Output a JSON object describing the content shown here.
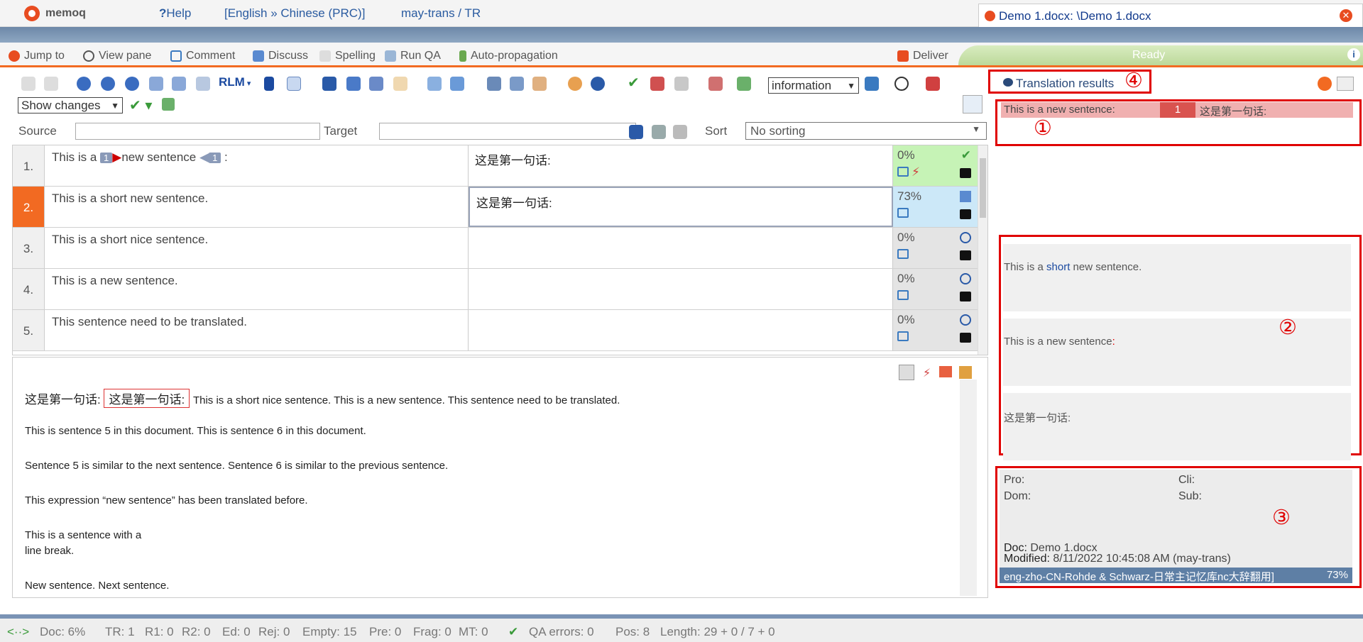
{
  "app": {
    "name": "memoq",
    "help": "Help",
    "lang": "[English » Chinese (PRC)]",
    "project": "may-trans / TR",
    "doc_tab": "Demo 1.docx: \\Demo 1.docx"
  },
  "ribbon": {
    "jump": "Jump to",
    "view": "View pane",
    "comment": "Comment",
    "discuss": "Discuss",
    "spelling": "Spelling",
    "runqa": "Run QA",
    "autoprop": "Auto-propagation",
    "deliver": "Deliver",
    "status": "Ready"
  },
  "toolbar": {
    "rlm": "RLM",
    "info_select": "information",
    "show_changes": "Show changes"
  },
  "filter": {
    "source": "Source",
    "target": "Target",
    "sort": "Sort",
    "sort_value": "No sorting"
  },
  "rows": [
    {
      "num": "1.",
      "src_a": "This is a",
      "tag_open": "1",
      "src_b": "new sentence",
      "tag_close": "1",
      "src_c": ":",
      "tgt": "这是第一句话:",
      "pct": "0%"
    },
    {
      "num": "2.",
      "src": "This is a short new sentence.",
      "tgt": "这是第一句话:",
      "pct": "73%"
    },
    {
      "num": "3.",
      "src": "This is a short nice sentence.",
      "tgt": "",
      "pct": "0%"
    },
    {
      "num": "4.",
      "src": "This is a new sentence.",
      "tgt": "",
      "pct": "0%"
    },
    {
      "num": "5.",
      "src": "This sentence need to be translated.",
      "tgt": "",
      "pct": "0%"
    }
  ],
  "preview": {
    "p1a": "这是第一句话:",
    "p1hl": "这是第一句话:",
    "p1b": "This is a short nice sentence. This is a new sentence. This sentence need to be translated.",
    "p2": "This is sentence 5 in this document. This is sentence 6 in this document.",
    "p3": "Sentence 5 is similar to the next sentence. Sentence 6 is similar to the previous sentence.",
    "p4": "This expression “new sentence” has been translated before.",
    "p5a": "This is a sentence with a",
    "p5b": "line break.",
    "p6": "New sentence. Next sentence."
  },
  "results": {
    "title": "Translation results",
    "r1_src": "This is a new sentence:",
    "r1_num": "1",
    "r1_tgt": "这是第一句话:",
    "r2a_pre": "This is a ",
    "r2a_hl": "short",
    "r2a_post": " new sentence.",
    "r2b": "This is a new sentence",
    "r2b_colon": ":",
    "r2c": "这是第一句话:"
  },
  "meta": {
    "pro": "Pro:",
    "cli": "Cli:",
    "dom": "Dom:",
    "sub": "Sub:",
    "doc_l": "Doc:",
    "doc": "Demo 1.docx",
    "mod_l": "Modified:",
    "mod": "8/11/2022 10:45:08 AM (may-trans)",
    "tm": "eng-zho-CN-Rohde & Schwarz-日常主记忆库nc大辞翻用]",
    "tm_pct": "73%"
  },
  "annotations": {
    "a1": "①",
    "a2": "②",
    "a3": "③",
    "a4": "④"
  },
  "status": {
    "doc": "Doc: 6%",
    "tr": "TR: 1",
    "r1": "R1: 0",
    "r2": "R2: 0",
    "ed": "Ed: 0",
    "rej": "Rej: 0",
    "empty": "Empty: 15",
    "pre": "Pre: 0",
    "frag": "Frag: 0",
    "mt": "MT: 0",
    "qa": "QA errors: 0",
    "pos": "Pos: 8",
    "len": "Length: 29 + 0 / 7 + 0"
  },
  "colors": {
    "accent": "#f26a22",
    "annotation": "#e00000",
    "confirmed": "#c6f3b6",
    "tm_match": "#cce8f8"
  }
}
